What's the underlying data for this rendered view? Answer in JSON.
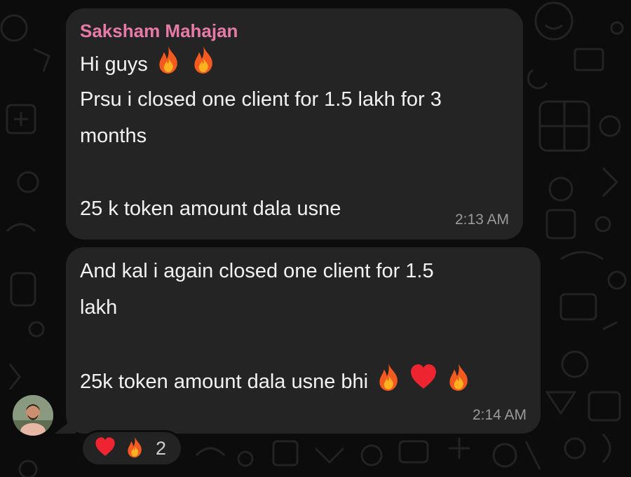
{
  "messages": [
    {
      "sender": "Saksham Mahajan",
      "lines": [
        "Hi guys",
        "Prsu i closed one client for 1.5 lakh for 3",
        "months",
        "",
        "25 k token amount dala usne"
      ],
      "time": "2:13 AM"
    },
    {
      "lines": [
        "And kal i again closed one client for 1.5",
        "lakh",
        "",
        "25k token amount dala usne bhi"
      ],
      "time": "2:14 AM"
    }
  ],
  "reactions": {
    "icons": [
      "heart-icon",
      "fire-icon"
    ],
    "count": "2"
  },
  "colors": {
    "background": "#0c0c0c",
    "bubble": "#242424",
    "sender_name": "#e87aa8",
    "text": "#f2f2f2",
    "timestamp": "#9a9a9a"
  }
}
